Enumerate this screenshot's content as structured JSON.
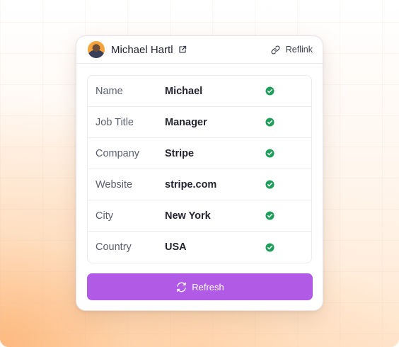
{
  "profile": {
    "name": "Michael Hartl",
    "reflink_label": "Reflink"
  },
  "fields": [
    {
      "label": "Name",
      "value": "Michael",
      "status": "verified"
    },
    {
      "label": "Job Title",
      "value": "Manager",
      "status": "verified"
    },
    {
      "label": "Company",
      "value": "Stripe",
      "status": "verified"
    },
    {
      "label": "Website",
      "value": "stripe.com",
      "status": "verified"
    },
    {
      "label": "City",
      "value": "New York",
      "status": "verified"
    },
    {
      "label": "Country",
      "value": "USA",
      "status": "verified"
    }
  ],
  "actions": {
    "refresh_label": "Refresh"
  },
  "colors": {
    "accent": "#b05ae6",
    "verified": "#1e9e5a"
  },
  "icons": {
    "external": "external-link-icon",
    "reflink": "link-icon",
    "check": "check-circle-icon",
    "refresh": "refresh-icon"
  }
}
